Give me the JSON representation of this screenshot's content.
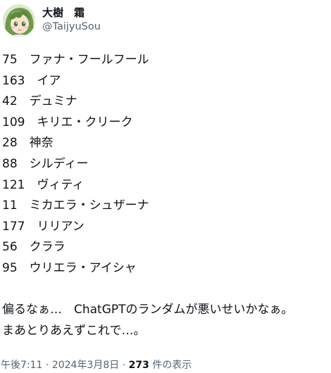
{
  "author": {
    "display_name": "大樹　霜",
    "handle": "@TaijyuSou",
    "avatar": "anime-character-avatar"
  },
  "tweet": {
    "lines": [
      "75　ファナ・フールフール",
      "163　イア",
      "42　デュミナ",
      "109　キリエ・クリーク",
      "28　神奈",
      "88　シルディー",
      "121　ヴィティ",
      "11　ミカエラ・シュザーナ",
      "177　リリアン",
      "56　クララ",
      "95　ウリエラ・アイシャ"
    ],
    "comment_lines": [
      "偏るなぁ…　ChatGPTのランダムが悪いせいかなぁ。",
      "まあとりあえずこれで…。"
    ]
  },
  "meta": {
    "time": "午後7:11",
    "separator": " · ",
    "date": "2024年3月8日",
    "views_count": "273",
    "views_label": " 件の表示"
  }
}
